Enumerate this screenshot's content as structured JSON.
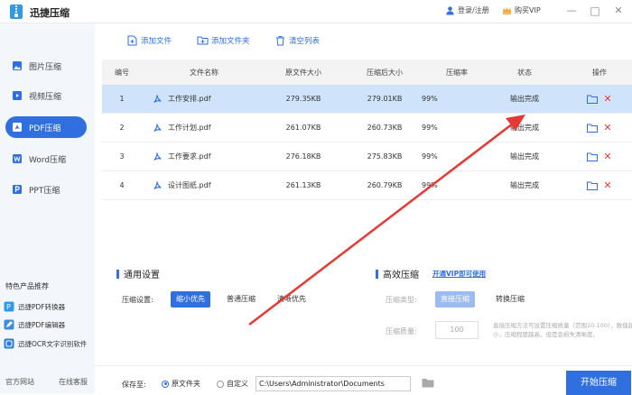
{
  "app": {
    "title": "迅捷压缩",
    "login_label": "登录/注册",
    "vip_label": "购买VIP",
    "minimize": "—",
    "maximize": "□",
    "close": "✕"
  },
  "sidebar": {
    "items": [
      {
        "label": "图片压缩",
        "icon": "image-icon"
      },
      {
        "label": "视频压缩",
        "icon": "video-icon"
      },
      {
        "label": "PDF压缩",
        "icon": "pdf-icon"
      },
      {
        "label": "Word压缩",
        "icon": "word-icon"
      },
      {
        "label": "PPT压缩",
        "icon": "ppt-icon"
      }
    ],
    "featured_title": "特色产品推荐",
    "featured": [
      {
        "label": "迅捷PDF转换器"
      },
      {
        "label": "迅捷PDF编辑器"
      },
      {
        "label": "迅捷OCR文字识别软件"
      }
    ],
    "official_site": "官方网站",
    "online_support": "在线客服"
  },
  "toolbar": {
    "add_file": "添加文件",
    "add_folder": "添加文件夹",
    "clear_list": "清空列表"
  },
  "table": {
    "headers": [
      "编号",
      "文件名称",
      "原文件大小",
      "压缩后大小",
      "压缩率",
      "状态",
      "操作"
    ],
    "rows": [
      {
        "num": "1",
        "name": "工作安排.pdf",
        "orig": "279.35KB",
        "comp": "279.01KB",
        "rate": "99%",
        "status": "输出完成"
      },
      {
        "num": "2",
        "name": "工作计划.pdf",
        "orig": "261.07KB",
        "comp": "260.73KB",
        "rate": "99%",
        "status": "输出完成"
      },
      {
        "num": "3",
        "name": "工作要求.pdf",
        "orig": "276.18KB",
        "comp": "275.83KB",
        "rate": "99%",
        "status": "输出完成"
      },
      {
        "num": "4",
        "name": "设计图纸.pdf",
        "orig": "261.13KB",
        "comp": "260.79KB",
        "rate": "99%",
        "status": "输出完成"
      }
    ]
  },
  "settings": {
    "general_title": "通用设置",
    "compress_label": "压缩设置:",
    "options": [
      "缩小优先",
      "普通压缩",
      "清晰优先"
    ],
    "efficient_title": "高效压缩",
    "vip_link": "开通VIP即可使用",
    "type_label": "压缩类型:",
    "type_options": [
      "直接压缩",
      "转换压缩"
    ],
    "quality_label": "压缩质量:",
    "quality_value": "100",
    "hint": "直接压缩方法可设置压缩质量（范围10-100），数值越小，压缩程度越高，但是会损失清晰度。"
  },
  "bottom": {
    "save_to": "保存至:",
    "radio_original": "原文件夹",
    "radio_custom": "自定义",
    "path": "C:\\Users\\Administrator\\Documents",
    "start": "开始压缩"
  },
  "colors": {
    "accent": "#2f6fe0",
    "selected_row": "#cfe4fb",
    "delete": "#e23b3b",
    "arrow": "#e53935"
  }
}
